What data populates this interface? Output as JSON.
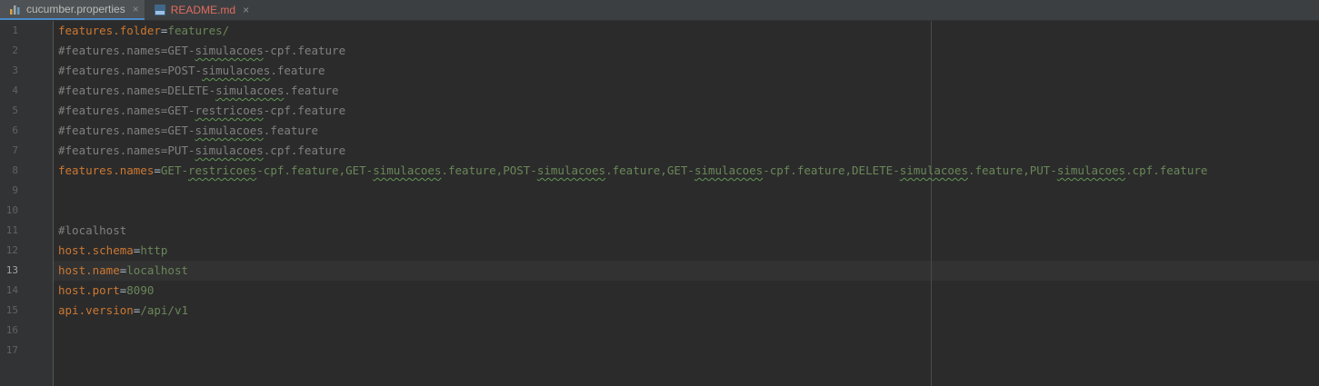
{
  "tabs": [
    {
      "label": "cucumber.properties",
      "icon": "properties-file-icon",
      "active": true
    },
    {
      "label": "README.md",
      "icon": "markdown-file-icon",
      "active": false
    }
  ],
  "close_glyph": "×",
  "lines": [
    {
      "num": "1",
      "segments": [
        {
          "t": "features.folder",
          "c": "k"
        },
        {
          "t": "=",
          "c": "p"
        },
        {
          "t": "features/",
          "c": "v"
        }
      ]
    },
    {
      "num": "2",
      "segments": [
        {
          "t": "#features.names=GET-",
          "c": "c"
        },
        {
          "t": "simulacoes",
          "c": "c sq"
        },
        {
          "t": "-cpf.feature",
          "c": "c"
        }
      ]
    },
    {
      "num": "3",
      "segments": [
        {
          "t": "#features.names=POST-",
          "c": "c"
        },
        {
          "t": "simulacoes",
          "c": "c sq"
        },
        {
          "t": ".feature",
          "c": "c"
        }
      ]
    },
    {
      "num": "4",
      "segments": [
        {
          "t": "#features.names=DELETE-",
          "c": "c"
        },
        {
          "t": "simulacoes",
          "c": "c sq"
        },
        {
          "t": ".feature",
          "c": "c"
        }
      ]
    },
    {
      "num": "5",
      "segments": [
        {
          "t": "#features.names=GET-",
          "c": "c"
        },
        {
          "t": "restricoes",
          "c": "c sq"
        },
        {
          "t": "-cpf.feature",
          "c": "c"
        }
      ]
    },
    {
      "num": "6",
      "segments": [
        {
          "t": "#features.names=GET-",
          "c": "c"
        },
        {
          "t": "simulacoes",
          "c": "c sq"
        },
        {
          "t": ".feature",
          "c": "c"
        }
      ]
    },
    {
      "num": "7",
      "segments": [
        {
          "t": "#features.names=PUT-",
          "c": "c"
        },
        {
          "t": "simulacoes",
          "c": "c sq"
        },
        {
          "t": ".cpf.feature",
          "c": "c"
        }
      ]
    },
    {
      "num": "8",
      "segments": [
        {
          "t": "features.names",
          "c": "k"
        },
        {
          "t": "=",
          "c": "p"
        },
        {
          "t": "GET-",
          "c": "v"
        },
        {
          "t": "restricoes",
          "c": "v sq"
        },
        {
          "t": "-cpf.feature,GET-",
          "c": "v"
        },
        {
          "t": "simulacoes",
          "c": "v sq"
        },
        {
          "t": ".feature,POST-",
          "c": "v"
        },
        {
          "t": "simulacoes",
          "c": "v sq"
        },
        {
          "t": ".feature,GET-",
          "c": "v"
        },
        {
          "t": "simulacoes",
          "c": "v sq"
        },
        {
          "t": "-cpf.feature,DELETE-",
          "c": "v"
        },
        {
          "t": "simulacoes",
          "c": "v sq"
        },
        {
          "t": ".feature,PUT-",
          "c": "v"
        },
        {
          "t": "simulacoes",
          "c": "v sq"
        },
        {
          "t": ".cpf.feature",
          "c": "v"
        }
      ]
    },
    {
      "num": "9",
      "segments": []
    },
    {
      "num": "10",
      "segments": []
    },
    {
      "num": "11",
      "segments": [
        {
          "t": "#localhost",
          "c": "c"
        }
      ]
    },
    {
      "num": "12",
      "segments": [
        {
          "t": "host.schema",
          "c": "k"
        },
        {
          "t": "=",
          "c": "p"
        },
        {
          "t": "http",
          "c": "v"
        }
      ]
    },
    {
      "num": "13",
      "segments": [
        {
          "t": "host.name",
          "c": "k"
        },
        {
          "t": "=",
          "c": "p"
        },
        {
          "t": "localhost",
          "c": "v"
        }
      ],
      "current": true
    },
    {
      "num": "14",
      "segments": [
        {
          "t": "host.port",
          "c": "k"
        },
        {
          "t": "=",
          "c": "p"
        },
        {
          "t": "8090",
          "c": "v"
        }
      ]
    },
    {
      "num": "15",
      "segments": [
        {
          "t": "api.version",
          "c": "k"
        },
        {
          "t": "=",
          "c": "p"
        },
        {
          "t": "/api/v1",
          "c": "v"
        }
      ]
    },
    {
      "num": "16",
      "segments": []
    },
    {
      "num": "17",
      "segments": []
    }
  ]
}
